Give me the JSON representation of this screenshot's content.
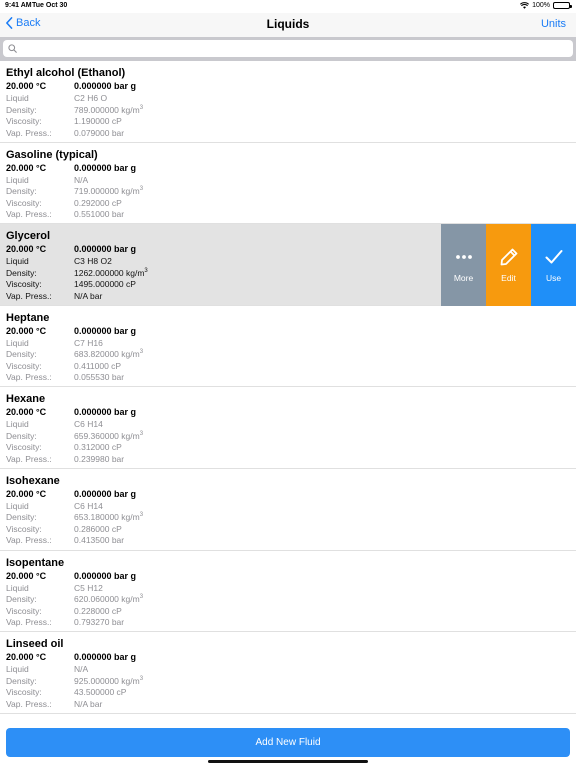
{
  "statusbar": {
    "time": "9:41 AM",
    "date": "Tue Oct 30",
    "battery": "100%"
  },
  "navbar": {
    "back_label": "Back",
    "title": "Liquids",
    "units_label": "Units"
  },
  "search": {
    "placeholder": ""
  },
  "labels": {
    "phase": "Liquid",
    "density": "Density:",
    "viscosity": "Viscosity:",
    "vap_press": "Vap. Press.:"
  },
  "fluids": [
    {
      "name": "Ethyl alcohol (Ethanol)",
      "temperature": "20.000 °C",
      "pressure": "0.000000 bar g",
      "formula": "C2 H6 O",
      "density": "789.000000 kg/m",
      "density_exp": "3",
      "viscosity": "1.190000 cP",
      "vap_press": "0.079000 bar"
    },
    {
      "name": "Gasoline (typical)",
      "temperature": "20.000 °C",
      "pressure": "0.000000 bar g",
      "formula": "N/A",
      "density": "719.000000 kg/m",
      "density_exp": "3",
      "viscosity": "0.292000 cP",
      "vap_press": "0.551000 bar"
    },
    {
      "name": "Glycerol",
      "temperature": "20.000 °C",
      "pressure": "0.000000 bar g",
      "formula": "C3 H8 O2",
      "density": "1262.000000 kg/m",
      "density_exp": "3",
      "viscosity": "1495.000000 cP",
      "vap_press": "N/A bar"
    },
    {
      "name": "Heptane",
      "temperature": "20.000 °C",
      "pressure": "0.000000 bar g",
      "formula": "C7 H16",
      "density": "683.820000 kg/m",
      "density_exp": "3",
      "viscosity": "0.411000 cP",
      "vap_press": "0.055530 bar"
    },
    {
      "name": "Hexane",
      "temperature": "20.000 °C",
      "pressure": "0.000000 bar g",
      "formula": "C6 H14",
      "density": "659.360000 kg/m",
      "density_exp": "3",
      "viscosity": "0.312000 cP",
      "vap_press": "0.239980 bar"
    },
    {
      "name": "Isohexane",
      "temperature": "20.000 °C",
      "pressure": "0.000000 bar g",
      "formula": "C6 H14",
      "density": "653.180000 kg/m",
      "density_exp": "3",
      "viscosity": "0.286000 cP",
      "vap_press": "0.413500 bar"
    },
    {
      "name": "Isopentane",
      "temperature": "20.000 °C",
      "pressure": "0.000000 bar g",
      "formula": "C5 H12",
      "density": "620.060000 kg/m",
      "density_exp": "3",
      "viscosity": "0.228000 cP",
      "vap_press": "0.793270 bar"
    },
    {
      "name": "Linseed oil",
      "temperature": "20.000 °C",
      "pressure": "0.000000 bar g",
      "formula": "N/A",
      "density": "925.000000 kg/m",
      "density_exp": "3",
      "viscosity": "43.500000 cP",
      "vap_press": "N/A bar"
    }
  ],
  "swipe_actions": {
    "more_label": "More",
    "edit_label": "Edit",
    "use_label": "Use"
  },
  "footer": {
    "add_button_label": "Add New Fluid"
  },
  "colors": {
    "accent": "#1a7cf6",
    "more": "#8596a6",
    "edit": "#f79a0e",
    "use": "#1f8ff8",
    "add_button": "#2d8ff6"
  }
}
